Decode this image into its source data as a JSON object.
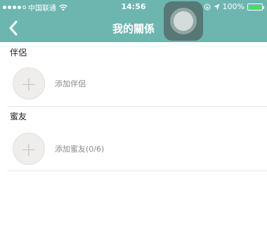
{
  "status": {
    "carrier": "中国联通",
    "time": "14:56",
    "battery": "100%"
  },
  "nav": {
    "title": "我的關係"
  },
  "sections": {
    "partner": {
      "heading": "伴侶",
      "add_label": "添加伴侶"
    },
    "friends": {
      "heading": "蜜友",
      "add_label": "添加蜜友(0/6)"
    }
  },
  "icons": {
    "back": "chevron-left-icon",
    "add": "plus-icon"
  },
  "colors": {
    "header": "#6db6b0",
    "battery": "#4cd964"
  }
}
